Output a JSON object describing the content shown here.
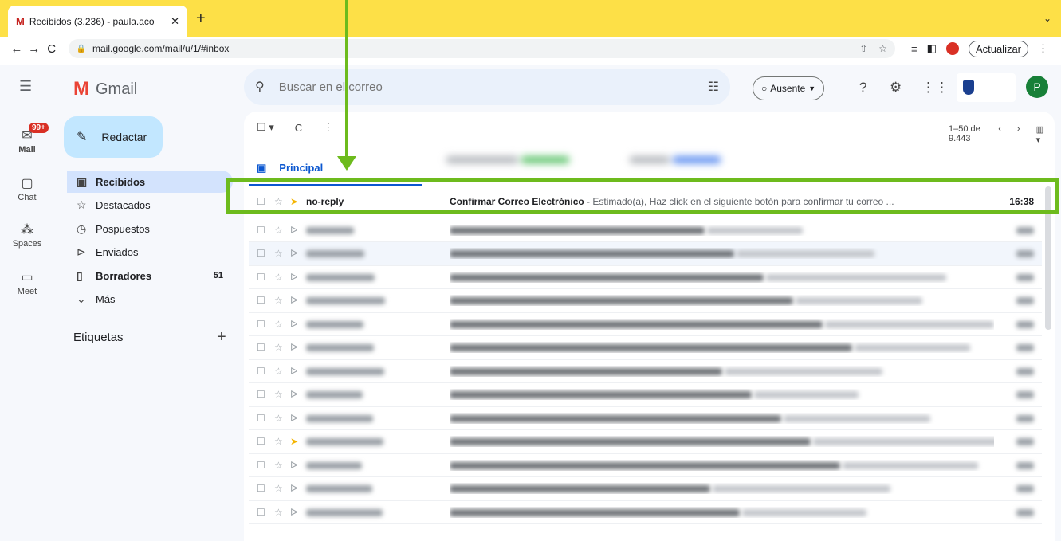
{
  "browser": {
    "tab_title": "Recibidos (3.236) - paula.aco",
    "tab_icon": "gmail-m-icon",
    "url": "mail.google.com/mail/u/1/#inbox",
    "update_label": "Actualizar",
    "tabbar_color": "#fde047"
  },
  "gmail": {
    "app_name": "Gmail",
    "compose_label": "Redactar",
    "search_placeholder": "Buscar en el correo",
    "status_label": "Ausente",
    "avatar_letter": "P",
    "rail": [
      {
        "label": "Mail",
        "icon": "mail-icon",
        "badge": "99+"
      },
      {
        "label": "Chat",
        "icon": "chat-icon"
      },
      {
        "label": "Spaces",
        "icon": "spaces-icon"
      },
      {
        "label": "Meet",
        "icon": "meet-icon"
      }
    ],
    "folders": [
      {
        "label": "Recibidos",
        "icon": "inbox-icon",
        "count": ""
      },
      {
        "label": "Destacados",
        "icon": "star-icon",
        "count": ""
      },
      {
        "label": "Pospuestos",
        "icon": "clock-icon",
        "count": ""
      },
      {
        "label": "Enviados",
        "icon": "send-icon",
        "count": ""
      },
      {
        "label": "Borradores",
        "icon": "draft-icon",
        "count": "51"
      },
      {
        "label": "Más",
        "icon": "chevron-down-icon",
        "count": ""
      }
    ],
    "labels_title": "Etiquetas",
    "pagination": "1–50 de 9.443",
    "primary_tab": "Principal",
    "emails": [
      {
        "sender": "no-reply",
        "subject": "Confirmar Correo Electrónico",
        "snippet": " - Estimado(a), Haz click en el siguiente botón para confirmar tu correo ...",
        "time": "16:38",
        "important": true
      }
    ],
    "accent_color": "#0b57d0",
    "annotation_color": "#6dbb1d"
  }
}
